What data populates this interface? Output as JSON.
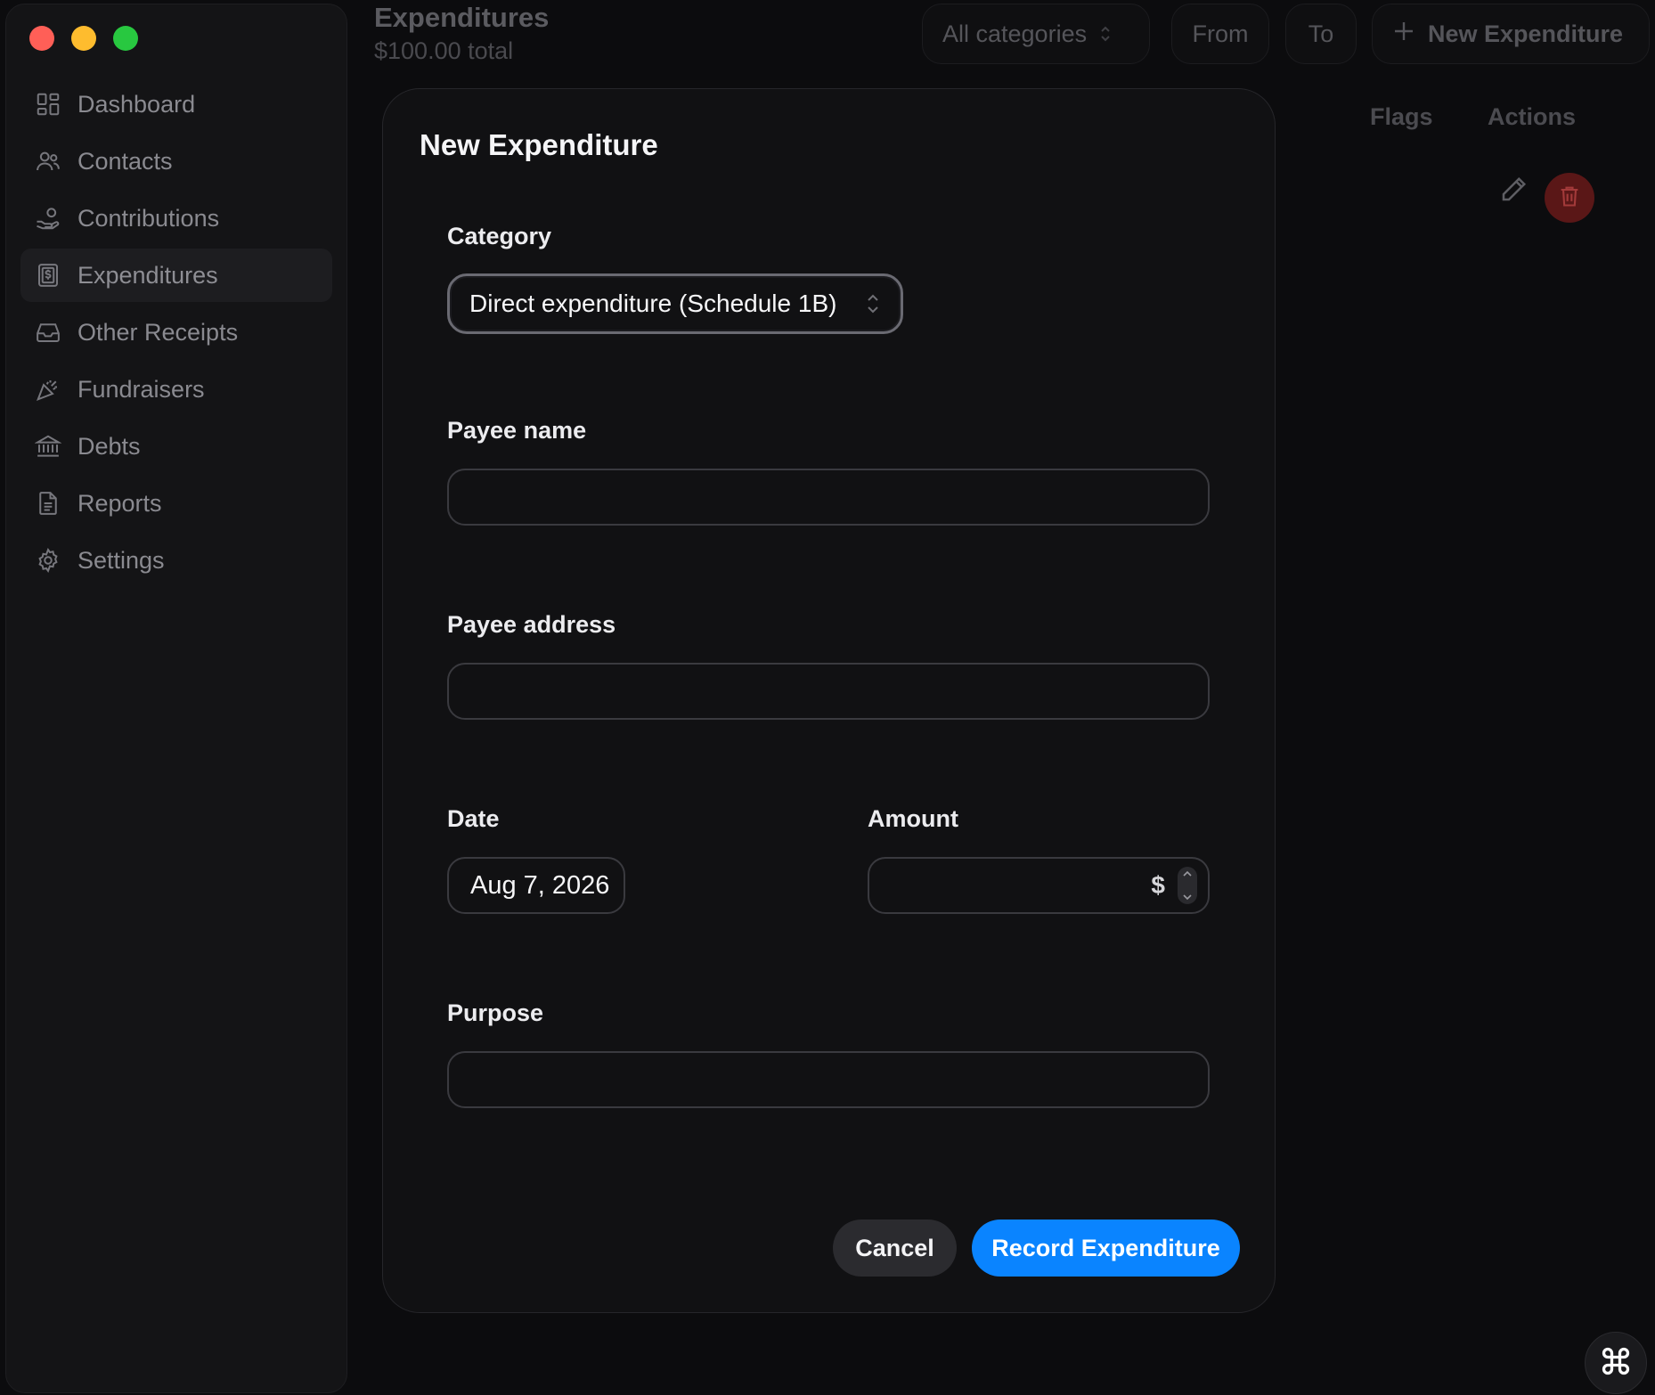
{
  "sidebar": {
    "items": [
      {
        "label": "Dashboard",
        "icon": "dashboard-icon"
      },
      {
        "label": "Contacts",
        "icon": "contacts-icon"
      },
      {
        "label": "Contributions",
        "icon": "contributions-icon"
      },
      {
        "label": "Expenditures",
        "icon": "expenditures-icon",
        "active": true
      },
      {
        "label": "Other Receipts",
        "icon": "inbox-icon"
      },
      {
        "label": "Fundraisers",
        "icon": "party-icon"
      },
      {
        "label": "Debts",
        "icon": "bank-icon"
      },
      {
        "label": "Reports",
        "icon": "document-icon"
      },
      {
        "label": "Settings",
        "icon": "gear-icon"
      }
    ]
  },
  "header": {
    "title": "Expenditures",
    "subtitle": "$100.00 total",
    "category_filter": "All categories",
    "from_label": "From",
    "to_label": "To",
    "new_button": "New Expenditure"
  },
  "table": {
    "columns": [
      "Flags",
      "Actions"
    ]
  },
  "modal": {
    "title": "New Expenditure",
    "category_label": "Category",
    "category_value": "Direct expenditure (Schedule 1B)",
    "payee_name_label": "Payee name",
    "payee_name_value": "",
    "payee_address_label": "Payee address",
    "payee_address_value": "",
    "date_label": "Date",
    "date_value": "Aug 7, 2026",
    "amount_label": "Amount",
    "amount_value": "",
    "currency_symbol": "$",
    "purpose_label": "Purpose",
    "purpose_value": "",
    "cancel_label": "Cancel",
    "submit_label": "Record Expenditure"
  },
  "colors": {
    "accent": "#0a84ff",
    "danger": "#5a1717",
    "traffic_red": "#ff5f57",
    "traffic_yellow": "#febc2e",
    "traffic_green": "#28c840"
  }
}
